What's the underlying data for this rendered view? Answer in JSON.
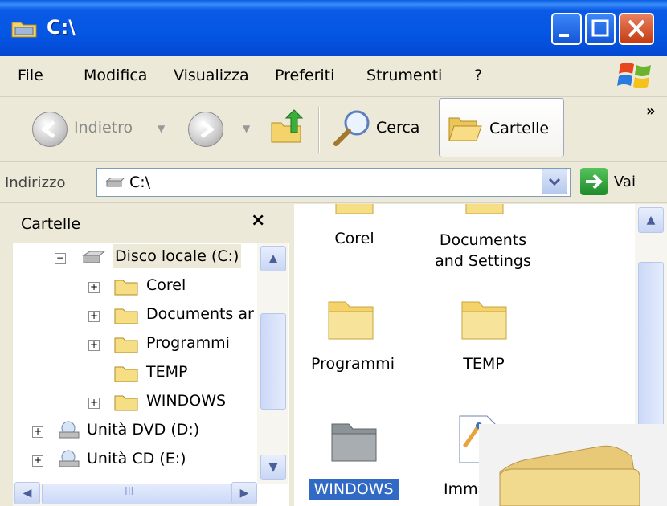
{
  "window": {
    "title": "C:\\"
  },
  "menu": [
    "File",
    "Modifica",
    "Visualizza",
    "Preferiti",
    "Strumenti",
    "?"
  ],
  "toolbar": {
    "back": "Indietro",
    "search": "Cerca",
    "folders": "Cartelle",
    "more": "»"
  },
  "address": {
    "label": "Indirizzo",
    "value": "C:\\",
    "go": "Vai"
  },
  "left_pane": {
    "title": "Cartelle",
    "close": "×",
    "tree": [
      {
        "label": "Disco locale (C:)",
        "expander": "−"
      },
      {
        "label": "Corel",
        "expander": "+"
      },
      {
        "label": "Documents ar",
        "expander": "+"
      },
      {
        "label": "Programmi",
        "expander": "+"
      },
      {
        "label": "TEMP",
        "expander": ""
      },
      {
        "label": "WINDOWS",
        "expander": "+"
      },
      {
        "label": "Unità DVD (D:)",
        "expander": "+"
      },
      {
        "label": "Unità CD (E:)",
        "expander": "+"
      }
    ],
    "hscroll_mark": "III"
  },
  "right_pane": {
    "items": [
      {
        "label": "Corel"
      },
      {
        "label": "Documents\nand Settings"
      },
      {
        "label": "Programmi"
      },
      {
        "label": "TEMP"
      },
      {
        "label": "WINDOWS"
      },
      {
        "label": "Imma"
      }
    ]
  },
  "colors": {
    "title_blue": "#0456E4",
    "selection": "#316AC5",
    "folder_yellow": "#F6DE84"
  }
}
